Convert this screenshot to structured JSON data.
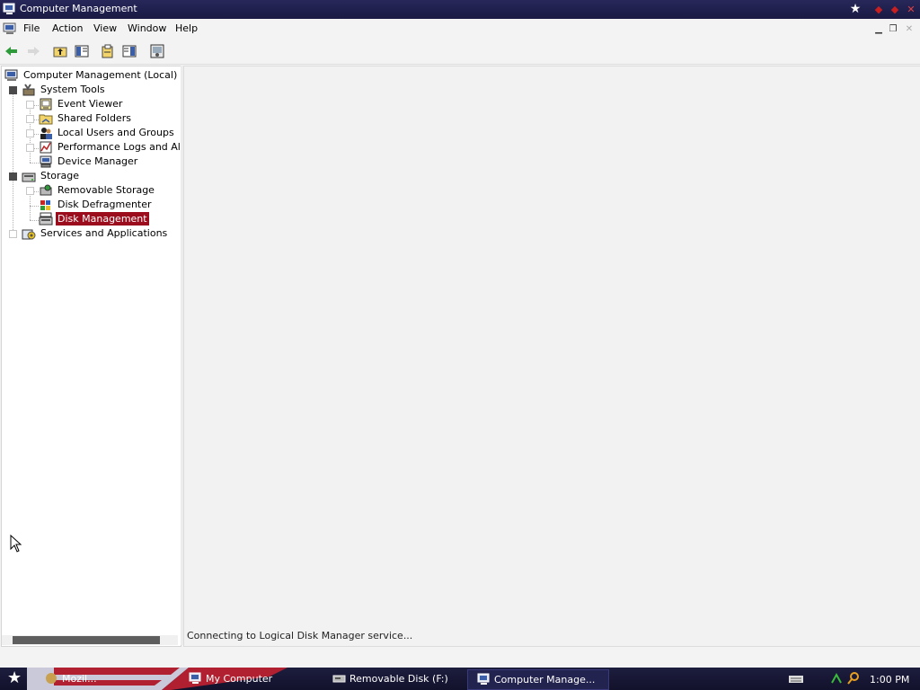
{
  "window": {
    "title": "Computer Management"
  },
  "menu": {
    "items": [
      "File",
      "Action",
      "View",
      "Window",
      "Help"
    ]
  },
  "tree": {
    "root": "Computer Management (Local)",
    "system_tools": "System Tools",
    "event_viewer": "Event Viewer",
    "shared_folders": "Shared Folders",
    "local_users": "Local Users and Groups",
    "perf_logs": "Performance Logs and Alerts",
    "device_manager": "Device Manager",
    "storage": "Storage",
    "removable_storage": "Removable Storage",
    "disk_defrag": "Disk Defragmenter",
    "disk_management": "Disk Management",
    "services_apps": "Services and Applications"
  },
  "status": {
    "text": "Connecting to Logical Disk Manager service..."
  },
  "taskbar": {
    "items": [
      "Mozil...",
      "My Computer",
      "Removable Disk (F:)",
      "Computer Manage..."
    ],
    "clock": "1:00 PM"
  },
  "colors": {
    "selection": "#9b0d1c",
    "titlebar": "#1a1a44"
  }
}
